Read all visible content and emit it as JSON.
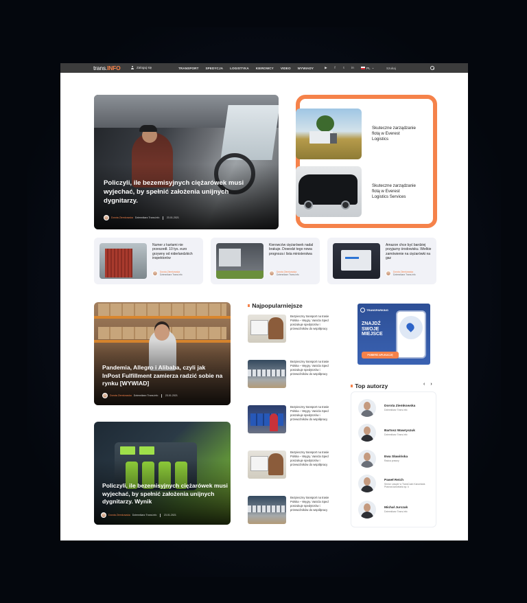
{
  "nav": {
    "logo_left": "trans.",
    "logo_right": "INFO",
    "login": "Zaloguj się",
    "menu": [
      "TRANSPORT",
      "SPEDYCJA",
      "LOGISTYKA",
      "KIEROWCY",
      "VIDEO",
      "WYWIADY"
    ],
    "social": [
      "▶",
      "f",
      "t",
      "in"
    ],
    "lang": "PL",
    "search_placeholder": "Szukaj"
  },
  "hero": {
    "title": "Policzyli, ile bezemisyjnych ciężarówek musi wyjechać, by spełnić założenia unijnych dygnitarzy.",
    "author": "Dorota Ziemkowska",
    "role": "Dziennikarz Trans.info",
    "date": "23.01.2021"
  },
  "sponsored": [
    {
      "title": "Skuteczne zarządzanie flotą w Everest Logistics"
    },
    {
      "title": "Skuteczne zarządzanie flotą w Everest Logistics Services"
    }
  ],
  "cards": [
    {
      "title": "Numer z kartami nie przeszedł. 10 tys. euro grzywny od niderlandzkich inspektorów",
      "author": "Dorota Ziemkowska",
      "role": "Dziennikarz Trans.info"
    },
    {
      "title": "Kierowców ciężarówek nadal brakuje. Dowodzi tego nowa prognoza i lista ministerstwa",
      "author": "Dorota Ziemkowska",
      "role": "Dziennikarz Trans.info"
    },
    {
      "title": "Amazon chce być bardziej przyjazny środowisku. Wielkie zamówienie na ciężarówki na gaz",
      "author": "Dorota Ziemkowska",
      "role": "Dziennikarz Trans.info"
    }
  ],
  "big_articles": [
    {
      "title": "Pandemia, Allegro i Alibaba, czyli jak InPost Fulfillment zamierza radzić sobie na rynku [WYWIAD]",
      "author": "Dorota Ziemkowska",
      "role": "Dziennikarz Trans.info",
      "date": "23.01.2021"
    },
    {
      "title": "Policzyli, ile bezemisyjnych ciężarówek musi wyjechać, by spełnić założenia unijnych dygnitarzy. Wynik",
      "author": "Dorota Ziemkowska",
      "role": "Dziennikarz Trans.info",
      "date": "23.01.2021"
    }
  ],
  "popular": {
    "title": "Najpopularniejsze",
    "items": [
      "Bezpieczny transport na trasie Polska – Węgry. Vanicla Sped poszukuje spedytorów i przewoźników do współpracy",
      "Bezpieczny transport na trasie Polska – Węgry. Vanicla Sped poszukuje spedytorów i przewoźników do współpracy",
      "Bezpieczny transport na trasie Polska – Węgry. Vanicla Sped poszukuje spedytorów i przewoźników do współpracy",
      "Bezpieczny transport na trasie Polska – Węgry. Vanicla Sped poszukuje spedytorów i przewoźników do współpracy",
      "Bezpieczny transport na trasie Polska – Węgry. Vanicla Sped poszukuje spedytorów i przewoźników do współpracy"
    ]
  },
  "ad": {
    "brand": "TRANSPARKING",
    "headline": "ZNAJDŹ SWOJE MIEJSCE",
    "button": "POBIERZ APLIKACJĘ"
  },
  "top_authors": {
    "title": "Top autorzy",
    "prev": "‹",
    "next": "›",
    "items": [
      {
        "name": "Dorota Ziemkowska",
        "role": "Dziennikarz Trans.info"
      },
      {
        "name": "Bartosz Wawryszuk",
        "role": "Dziennikarz Trans.info"
      },
      {
        "name": "Ewa Sławińska",
        "role": "Radca prawny"
      },
      {
        "name": "Paweł Reich",
        "role": "Senior Lawyer w TransCash Kancelaria Prawna kancelaria sp. k"
      },
      {
        "name": "Michał Jurczak",
        "role": "Dziennikarz Trans.info"
      }
    ]
  }
}
